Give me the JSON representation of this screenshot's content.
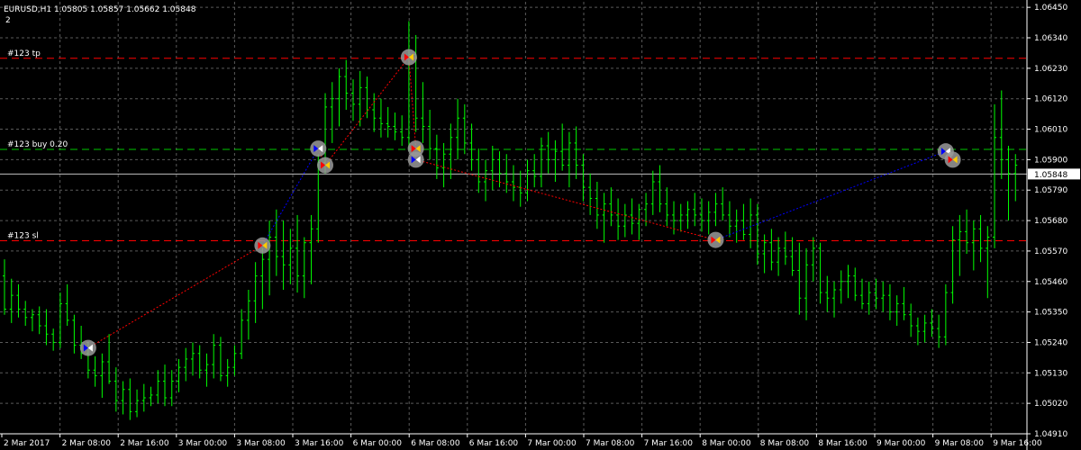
{
  "window": {
    "title": "EURUSD,H1  1.05805 1.05857 1.05662 1.05848",
    "subwindow_number": "2"
  },
  "colors": {
    "background": "#000000",
    "grid": "#5a5a5a",
    "candle": "#00ff00",
    "tp_line": "#ff0000",
    "sl_line": "#ff0000",
    "entry_line": "#00c800",
    "bid_line": "#c0c0c0",
    "buy_trade": "#0000ff",
    "sell_trade": "#ff0000",
    "price_label_bg": "#ffffff",
    "price_label_fg": "#000000"
  },
  "chart_data": {
    "type": "ohlc",
    "symbol": "EURUSD",
    "timeframe": "H1",
    "ylim": [
      1.0491,
      1.0647
    ],
    "y_ticks": [
      "1.06450",
      "1.06340",
      "1.06230",
      "1.06120",
      "1.06010",
      "1.05900",
      "1.05790",
      "1.05680",
      "1.05570",
      "1.05460",
      "1.05350",
      "1.05240",
      "1.05130",
      "1.05020",
      "1.04910"
    ],
    "current_price": "1.05848",
    "x_ticks": [
      "2 Mar 2017",
      "2 Mar 08:00",
      "2 Mar 16:00",
      "3 Mar 00:00",
      "3 Mar 08:00",
      "3 Mar 16:00",
      "6 Mar 00:00",
      "6 Mar 08:00",
      "6 Mar 16:00",
      "7 Mar 00:00",
      "7 Mar 08:00",
      "7 Mar 16:00",
      "8 Mar 00:00",
      "8 Mar 08:00",
      "8 Mar 16:00",
      "9 Mar 00:00",
      "9 Mar 08:00",
      "9 Mar 16:00"
    ],
    "levels": [
      {
        "name": "#123 tp",
        "price": 1.06266,
        "kind": "tp"
      },
      {
        "name": "#123 buy 0.20",
        "price": 1.05937,
        "kind": "entry"
      },
      {
        "name": "#123 sl",
        "price": 1.05607,
        "kind": "sl"
      }
    ],
    "bars": [
      [
        1.0548,
        1.0554,
        1.0534,
        1.0536
      ],
      [
        1.0536,
        1.0547,
        1.0531,
        1.0541
      ],
      [
        1.0541,
        1.0545,
        1.0533,
        1.0536
      ],
      [
        1.0536,
        1.0539,
        1.053,
        1.0533
      ],
      [
        1.0533,
        1.0536,
        1.0528,
        1.0534
      ],
      [
        1.0534,
        1.0537,
        1.0527,
        1.053
      ],
      [
        1.053,
        1.0536,
        1.0523,
        1.0527
      ],
      [
        1.0527,
        1.0529,
        1.0521,
        1.0524
      ],
      [
        1.0524,
        1.0542,
        1.0522,
        1.0538
      ],
      [
        1.0538,
        1.0545,
        1.053,
        1.0532
      ],
      [
        1.0532,
        1.0534,
        1.052,
        1.0523
      ],
      [
        1.0523,
        1.053,
        1.0518,
        1.052
      ],
      [
        1.052,
        1.0524,
        1.0511,
        1.0514
      ],
      [
        1.0514,
        1.0519,
        1.0508,
        1.0512
      ],
      [
        1.0512,
        1.052,
        1.0504,
        1.0517
      ],
      [
        1.0517,
        1.0527,
        1.0509,
        1.051
      ],
      [
        1.051,
        1.0515,
        1.0499,
        1.0503
      ],
      [
        1.0503,
        1.051,
        1.0498,
        1.0507
      ],
      [
        1.0507,
        1.0511,
        1.0496,
        1.0499
      ],
      [
        1.0499,
        1.0507,
        1.0497,
        1.0503
      ],
      [
        1.0503,
        1.0509,
        1.0499,
        1.0504
      ],
      [
        1.0504,
        1.0508,
        1.0501,
        1.0505
      ],
      [
        1.0505,
        1.0514,
        1.0502,
        1.051
      ],
      [
        1.051,
        1.0516,
        1.0501,
        1.0504
      ],
      [
        1.0504,
        1.0514,
        1.0501,
        1.051
      ],
      [
        1.051,
        1.0518,
        1.0506,
        1.0515
      ],
      [
        1.0515,
        1.0522,
        1.051,
        1.0518
      ],
      [
        1.0518,
        1.0524,
        1.0512,
        1.052
      ],
      [
        1.052,
        1.0523,
        1.0511,
        1.0514
      ],
      [
        1.0514,
        1.052,
        1.0508,
        1.0516
      ],
      [
        1.0516,
        1.0527,
        1.0511,
        1.0523
      ],
      [
        1.0523,
        1.0526,
        1.051,
        1.0512
      ],
      [
        1.0512,
        1.0518,
        1.0508,
        1.0515
      ],
      [
        1.0515,
        1.0523,
        1.0512,
        1.052
      ],
      [
        1.052,
        1.0536,
        1.0518,
        1.0532
      ],
      [
        1.0532,
        1.0543,
        1.0525,
        1.0539
      ],
      [
        1.0539,
        1.0553,
        1.0531,
        1.0548
      ],
      [
        1.0548,
        1.0558,
        1.0536,
        1.0554
      ],
      [
        1.0554,
        1.0568,
        1.0541,
        1.0562
      ],
      [
        1.0562,
        1.0572,
        1.0548,
        1.0555
      ],
      [
        1.0555,
        1.0568,
        1.0543,
        1.0552
      ],
      [
        1.0552,
        1.0565,
        1.0545,
        1.0558
      ],
      [
        1.0558,
        1.057,
        1.0542,
        1.0548
      ],
      [
        1.0548,
        1.0562,
        1.054,
        1.056
      ],
      [
        1.056,
        1.057,
        1.0545,
        1.0565
      ],
      [
        1.0565,
        1.0592,
        1.056,
        1.0589
      ],
      [
        1.0589,
        1.0614,
        1.0585,
        1.0609
      ],
      [
        1.0609,
        1.0618,
        1.0596,
        1.0612
      ],
      [
        1.0612,
        1.0623,
        1.0602,
        1.062
      ],
      [
        1.062,
        1.0626,
        1.0608,
        1.0614
      ],
      [
        1.0614,
        1.0619,
        1.0604,
        1.061
      ],
      [
        1.061,
        1.0622,
        1.0602,
        1.0616
      ],
      [
        1.0616,
        1.062,
        1.0605,
        1.0608
      ],
      [
        1.0608,
        1.0614,
        1.06,
        1.0605
      ],
      [
        1.0605,
        1.0612,
        1.0598,
        1.0603
      ],
      [
        1.0603,
        1.0609,
        1.0598,
        1.0602
      ],
      [
        1.0602,
        1.0607,
        1.0597,
        1.06
      ],
      [
        1.06,
        1.0606,
        1.0595,
        1.0598
      ],
      [
        1.0598,
        1.064,
        1.0593,
        1.0628
      ],
      [
        1.0628,
        1.0635,
        1.06,
        1.0605
      ],
      [
        1.0605,
        1.0618,
        1.0596,
        1.0602
      ],
      [
        1.0602,
        1.0608,
        1.059,
        1.0594
      ],
      [
        1.0594,
        1.0599,
        1.0583,
        1.0587
      ],
      [
        1.0587,
        1.0596,
        1.058,
        1.0592
      ],
      [
        1.0592,
        1.0603,
        1.0583,
        1.0598
      ],
      [
        1.0598,
        1.0612,
        1.059,
        1.0605
      ],
      [
        1.0605,
        1.061,
        1.0592,
        1.0596
      ],
      [
        1.0596,
        1.0603,
        1.0586,
        1.059
      ],
      [
        1.059,
        1.0594,
        1.0578,
        1.0582
      ],
      [
        1.0582,
        1.059,
        1.0575,
        1.0586
      ],
      [
        1.0586,
        1.0595,
        1.0579,
        1.059
      ],
      [
        1.059,
        1.0593,
        1.058,
        1.0585
      ],
      [
        1.0585,
        1.0592,
        1.0578,
        1.0582
      ],
      [
        1.0582,
        1.0588,
        1.0575,
        1.058
      ],
      [
        1.058,
        1.0586,
        1.0573,
        1.0578
      ],
      [
        1.0578,
        1.059,
        1.0575,
        1.0586
      ],
      [
        1.0586,
        1.0592,
        1.058,
        1.0584
      ],
      [
        1.0584,
        1.0598,
        1.058,
        1.0595
      ],
      [
        1.0595,
        1.06,
        1.0585,
        1.059
      ],
      [
        1.059,
        1.0597,
        1.0582,
        1.0593
      ],
      [
        1.0593,
        1.0603,
        1.0586,
        1.0588
      ],
      [
        1.0588,
        1.06,
        1.058,
        1.0596
      ],
      [
        1.0596,
        1.0602,
        1.0583,
        1.0588
      ],
      [
        1.0588,
        1.0592,
        1.0575,
        1.058
      ],
      [
        1.058,
        1.0585,
        1.057,
        1.0576
      ],
      [
        1.0576,
        1.0582,
        1.0565,
        1.057
      ],
      [
        1.057,
        1.0578,
        1.056,
        1.0574
      ],
      [
        1.0574,
        1.058,
        1.0566,
        1.057
      ],
      [
        1.057,
        1.0576,
        1.0561,
        1.0566
      ],
      [
        1.0566,
        1.0574,
        1.0562,
        1.057
      ],
      [
        1.057,
        1.0576,
        1.0563,
        1.0567
      ],
      [
        1.0567,
        1.0574,
        1.0561,
        1.0572
      ],
      [
        1.0572,
        1.0578,
        1.0566,
        1.0574
      ],
      [
        1.0574,
        1.0586,
        1.057,
        1.0582
      ],
      [
        1.0582,
        1.0588,
        1.0571,
        1.0574
      ],
      [
        1.0574,
        1.058,
        1.0566,
        1.057
      ],
      [
        1.057,
        1.0575,
        1.0563,
        1.0568
      ],
      [
        1.0568,
        1.0574,
        1.0564,
        1.057
      ],
      [
        1.057,
        1.0575,
        1.0565,
        1.0572
      ],
      [
        1.0572,
        1.0578,
        1.0566,
        1.057
      ],
      [
        1.057,
        1.0576,
        1.0564,
        1.0568
      ],
      [
        1.0568,
        1.0575,
        1.0563,
        1.0571
      ],
      [
        1.0571,
        1.0578,
        1.0566,
        1.0574
      ],
      [
        1.0574,
        1.058,
        1.0568,
        1.057
      ],
      [
        1.057,
        1.0575,
        1.0562,
        1.0566
      ],
      [
        1.0566,
        1.0572,
        1.056,
        1.0568
      ],
      [
        1.0568,
        1.0574,
        1.0561,
        1.0563
      ],
      [
        1.0563,
        1.0576,
        1.0558,
        1.057
      ],
      [
        1.057,
        1.0574,
        1.0552,
        1.0556
      ],
      [
        1.0556,
        1.0563,
        1.0549,
        1.056
      ],
      [
        1.056,
        1.0565,
        1.055,
        1.0553
      ],
      [
        1.0553,
        1.0562,
        1.0548,
        1.0558
      ],
      [
        1.0558,
        1.0564,
        1.0552,
        1.0555
      ],
      [
        1.0555,
        1.0562,
        1.0548,
        1.055
      ],
      [
        1.055,
        1.056,
        1.0534,
        1.054
      ],
      [
        1.054,
        1.0558,
        1.0532,
        1.0552
      ],
      [
        1.0552,
        1.0562,
        1.0546,
        1.0558
      ],
      [
        1.0558,
        1.056,
        1.0538,
        1.0542
      ],
      [
        1.0542,
        1.0548,
        1.0535,
        1.054
      ],
      [
        1.054,
        1.0546,
        1.0533,
        1.0543
      ],
      [
        1.0543,
        1.055,
        1.0538,
        1.0546
      ],
      [
        1.0546,
        1.0552,
        1.054,
        1.0548
      ],
      [
        1.0548,
        1.0551,
        1.0539,
        1.0541
      ],
      [
        1.0541,
        1.0547,
        1.0536,
        1.0538
      ],
      [
        1.0538,
        1.0546,
        1.0534,
        1.0542
      ],
      [
        1.0542,
        1.0547,
        1.0536,
        1.054
      ],
      [
        1.054,
        1.0546,
        1.0535,
        1.0541
      ],
      [
        1.0541,
        1.0545,
        1.0532,
        1.0535
      ],
      [
        1.0535,
        1.0541,
        1.053,
        1.0538
      ],
      [
        1.0538,
        1.0544,
        1.0532,
        1.0534
      ],
      [
        1.0534,
        1.0538,
        1.0526,
        1.053
      ],
      [
        1.053,
        1.0533,
        1.0523,
        1.0528
      ],
      [
        1.0528,
        1.0534,
        1.0524,
        1.0531
      ],
      [
        1.0531,
        1.0536,
        1.0526,
        1.0529
      ],
      [
        1.0529,
        1.0534,
        1.0522,
        1.0526
      ],
      [
        1.0526,
        1.0545,
        1.0523,
        1.0542
      ],
      [
        1.0542,
        1.0566,
        1.0538,
        1.0561
      ],
      [
        1.0561,
        1.057,
        1.0548,
        1.0564
      ],
      [
        1.0564,
        1.0572,
        1.0556,
        1.056
      ],
      [
        1.056,
        1.0568,
        1.055,
        1.0565
      ],
      [
        1.0565,
        1.057,
        1.0553,
        1.0558
      ],
      [
        1.0558,
        1.0566,
        1.054,
        1.0562
      ],
      [
        1.0562,
        1.061,
        1.0558,
        1.0598
      ],
      [
        1.0598,
        1.0615,
        1.0583,
        1.059
      ],
      [
        1.059,
        1.0595,
        1.0568,
        1.0585
      ],
      [
        1.0585,
        1.0592,
        1.0575,
        1.0588
      ]
    ],
    "trades": [
      {
        "side": "buy",
        "bar": 12,
        "price": 1.0522
      },
      {
        "side": "sell",
        "bar": 37,
        "price": 1.0559
      },
      {
        "side": "buy",
        "bar": 45,
        "price": 1.0594
      },
      {
        "side": "sell",
        "bar": 46,
        "price": 1.0588
      },
      {
        "side": "sell",
        "bar": 58,
        "price": 1.0627
      },
      {
        "side": "sell",
        "bar": 59,
        "price": 1.0594
      },
      {
        "side": "buy",
        "bar": 59,
        "price": 1.059
      },
      {
        "side": "sell",
        "bar": 102,
        "price": 1.0561
      },
      {
        "side": "buy",
        "bar": 135,
        "price": 1.0593
      },
      {
        "side": "sell",
        "bar": 136,
        "price": 1.059
      }
    ]
  }
}
